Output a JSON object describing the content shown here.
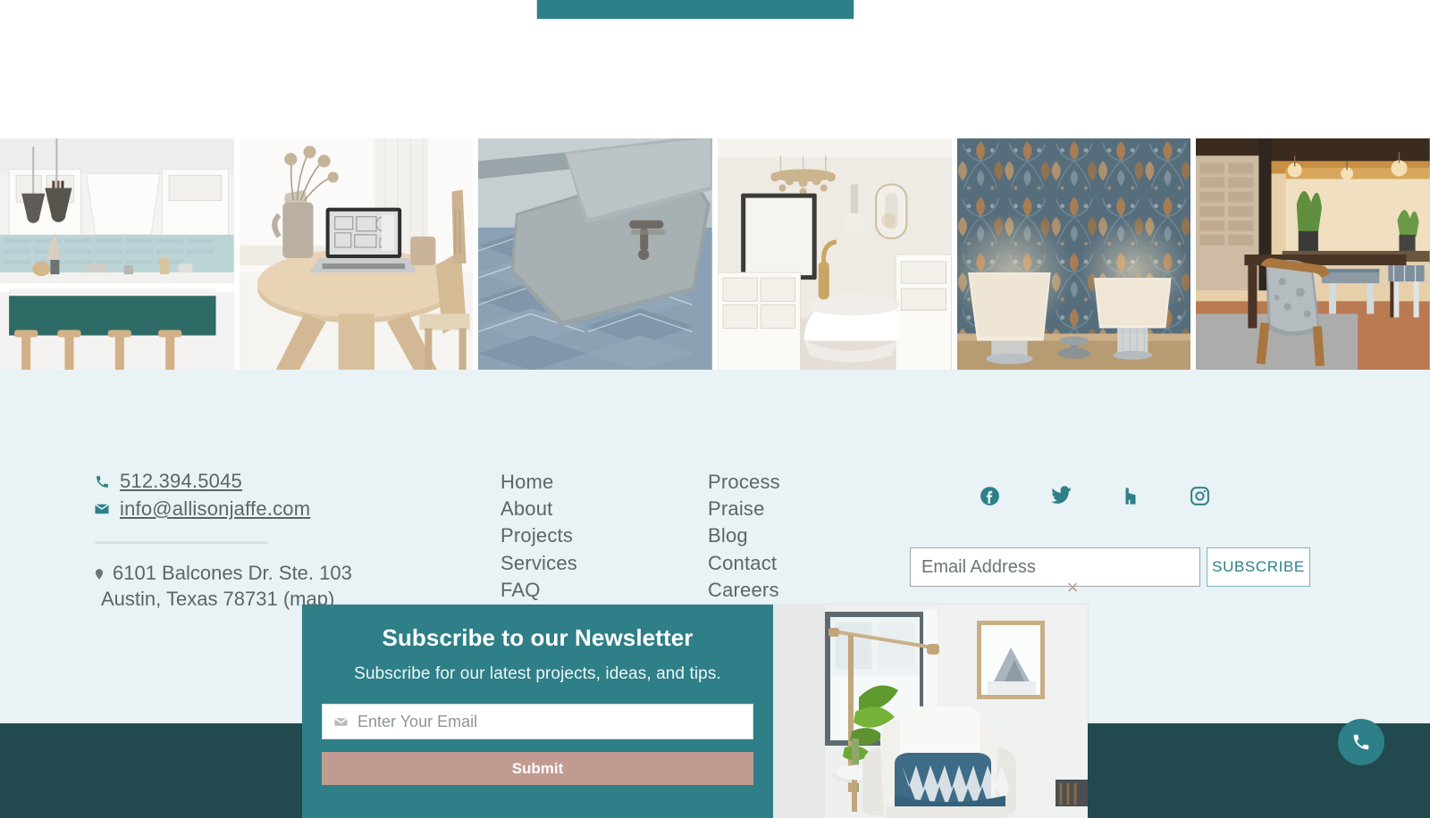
{
  "theme": {
    "teal": "#2e8088",
    "teal_modal": "#2e7f87",
    "dark_teal": "#22494e",
    "light_bg": "#e9f2f4",
    "rose": "#c19b92",
    "text_grey": "#5d6567"
  },
  "top_bar": {
    "label": ""
  },
  "gallery": {
    "items": [
      {
        "name": "white-kitchen-pendant-lights",
        "alt": "White kitchen with black pendant lights, blue tile backsplash and teal island"
      },
      {
        "name": "dining-table-laptop",
        "alt": "Round wood dining table with laptop, ceramic vase and dried flowers"
      },
      {
        "name": "tile-and-fabric-samples",
        "alt": "Grey stone tile samples over blue chevron patterned textile"
      },
      {
        "name": "bathroom-freestanding-tub",
        "alt": "Neutral bathroom with chandelier, freestanding white tub and gold fixtures"
      },
      {
        "name": "floral-wallpaper-lamps",
        "alt": "Blue floral wallpaper with two glass table lamps on a wood console"
      },
      {
        "name": "warm-dining-bar-area",
        "alt": "Warm dining area with upholstered chairs, stone column and bar stools"
      }
    ]
  },
  "footer": {
    "contact": {
      "phone": "512.394.5045",
      "email": "info@allisonjaffe.com",
      "address_line1": "6101 Balcones Dr. Ste. 103",
      "address_line2": "Austin, Texas 78731 (map)"
    },
    "nav_col1": [
      "Home",
      "About",
      "Projects",
      "Services",
      "FAQ"
    ],
    "nav_col2": [
      "Process",
      "Praise",
      "Blog",
      "Contact",
      "Careers"
    ],
    "social": [
      {
        "name": "facebook-icon",
        "label": "Facebook"
      },
      {
        "name": "twitter-icon",
        "label": "Twitter"
      },
      {
        "name": "houzz-icon",
        "label": "Houzz"
      },
      {
        "name": "instagram-icon",
        "label": "Instagram"
      }
    ],
    "subscribe": {
      "placeholder": "Email Address",
      "value": "",
      "button_label": "SUBSCRIBE"
    }
  },
  "fab": {
    "name": "phone-icon",
    "label": "Call"
  },
  "modal": {
    "title": "Subscribe to our Newsletter",
    "subtitle": "Subscribe for our latest projects, ideas, and tips.",
    "email_placeholder": "Enter Your Email",
    "email_value": "",
    "submit_label": "Submit",
    "close_label": "×",
    "image_alt": "Living room with white armchair, blue ikat pillow, floor lamp, plant and framed art"
  }
}
